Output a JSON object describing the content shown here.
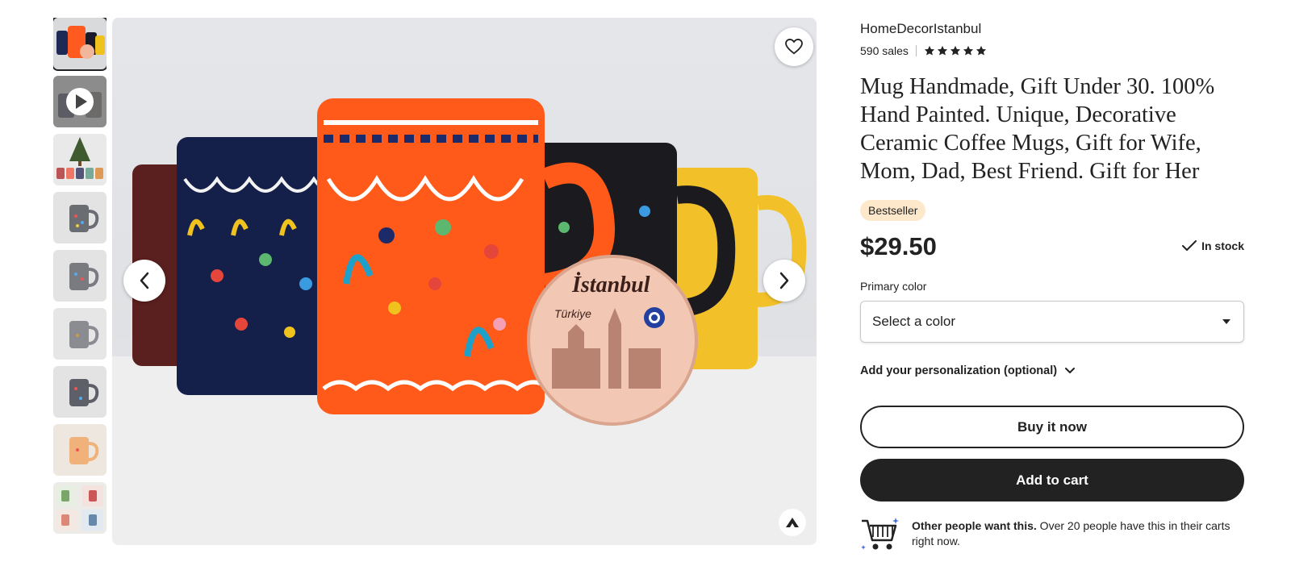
{
  "gallery": {
    "thumbnails": [
      {
        "kind": "image",
        "active": true
      },
      {
        "kind": "video",
        "active": false
      },
      {
        "kind": "image",
        "active": false
      },
      {
        "kind": "image",
        "active": false
      },
      {
        "kind": "image",
        "active": false
      },
      {
        "kind": "image",
        "active": false
      },
      {
        "kind": "image",
        "active": false
      },
      {
        "kind": "image",
        "active": false
      },
      {
        "kind": "image",
        "active": false
      }
    ],
    "icons": {
      "favorite": "heart-icon",
      "prev": "chevron-left-icon",
      "next": "chevron-right-icon",
      "play": "play-icon",
      "watermark": "brand-logo-icon"
    },
    "coaster_text": "İstanbul",
    "coaster_subtext": "Türkiye"
  },
  "listing": {
    "shop_name": "HomeDecorIstanbul",
    "sales": "590 sales",
    "rating_stars": 5,
    "title": "Mug Handmade, Gift Under 30. 100% Hand Painted. Unique, Decorative Ceramic Coffee Mugs, Gift for Wife, Mom, Dad, Best Friend. Gift for Her",
    "badge": "Bestseller",
    "price": "$29.50",
    "stock_status": "In stock",
    "color_label": "Primary color",
    "color_select_value": "Select a color",
    "personalization_label": "Add your personalization (optional)",
    "buy_now_label": "Buy it now",
    "add_to_cart_label": "Add to cart",
    "social_proof_bold": "Other people want this.",
    "social_proof_text": " Over 20 people have this in their carts right now."
  },
  "colors": {
    "text": "#222222",
    "badge_bg": "#fde8cc",
    "button_dark": "#222222",
    "star": "#222222"
  }
}
